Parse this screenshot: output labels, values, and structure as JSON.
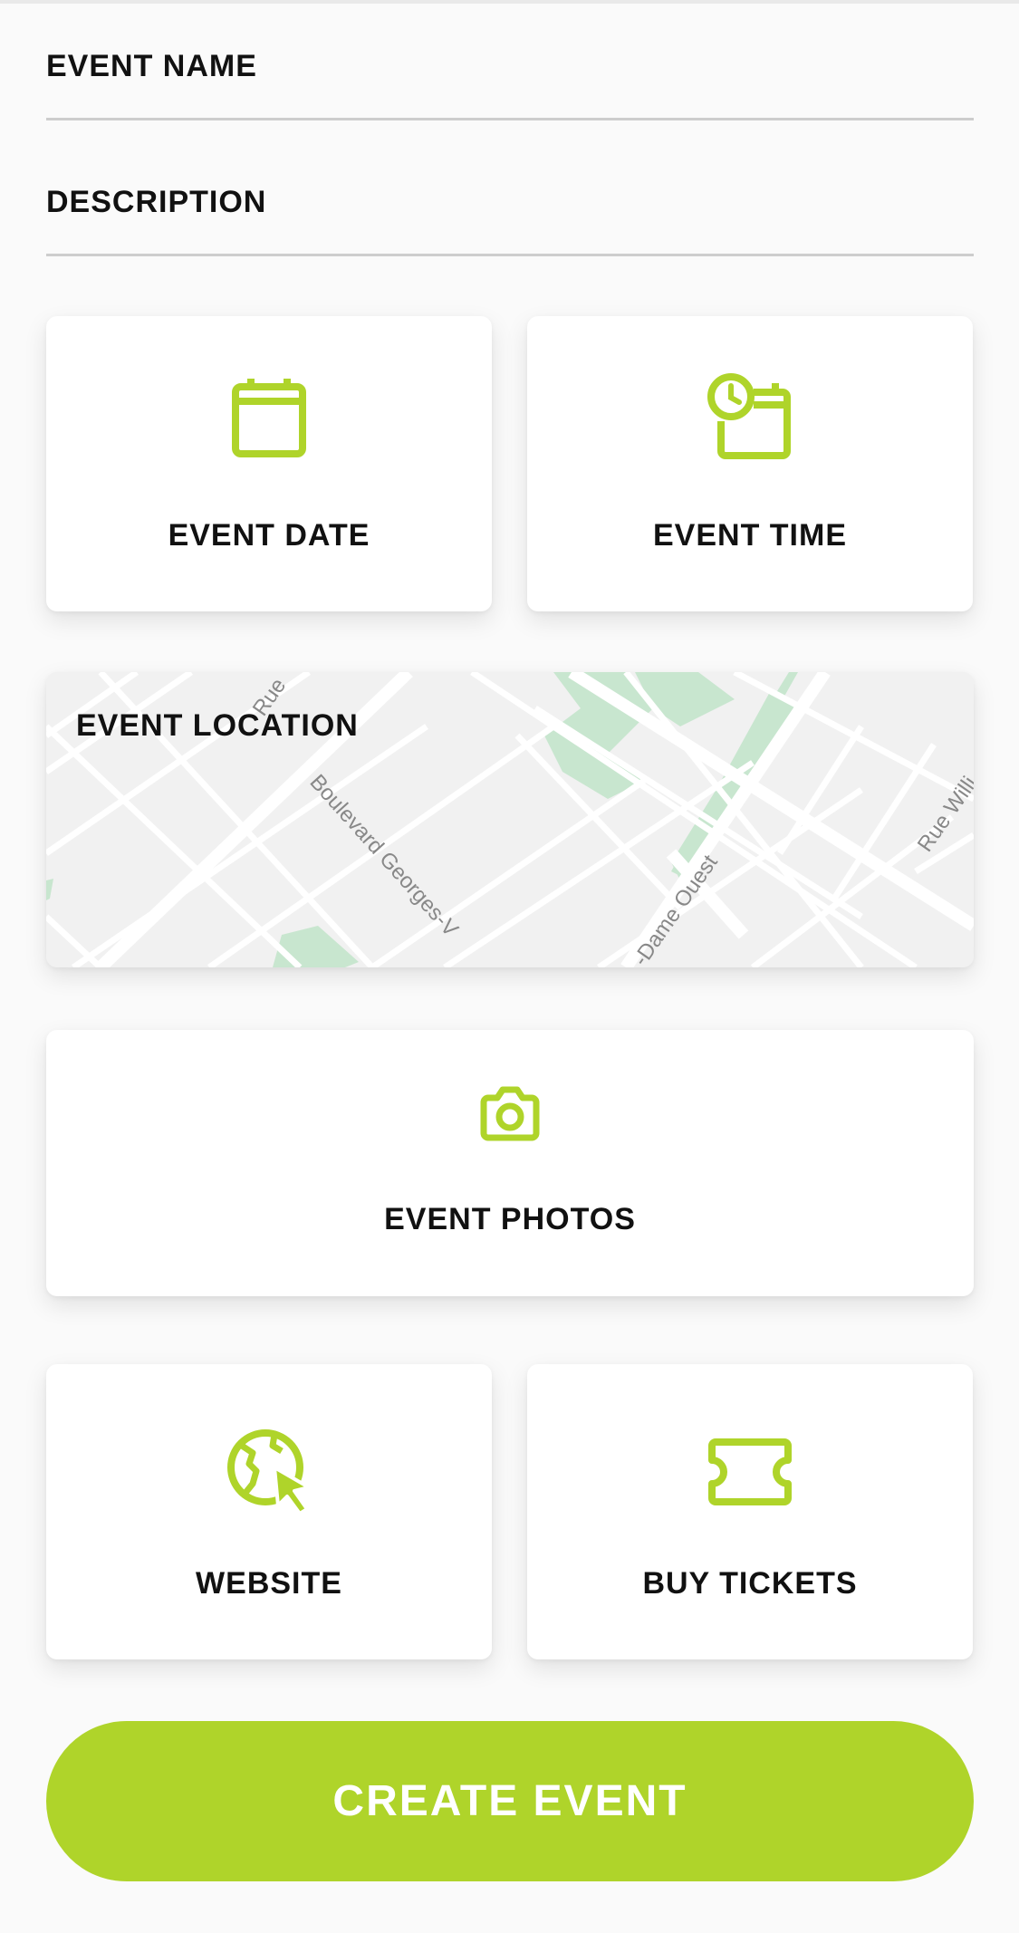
{
  "form": {
    "event_name_label": "EVENT NAME",
    "description_label": "DESCRIPTION"
  },
  "tiles": {
    "date": {
      "label": "EVENT DATE",
      "icon": "calendar-icon"
    },
    "time": {
      "label": "EVENT TIME",
      "icon": "clock-calendar-icon"
    },
    "location": {
      "label": "EVENT LOCATION",
      "streets": [
        "Rue",
        "Boulevard Georges-V",
        "-Dame Ouest",
        "Rue Willi"
      ]
    },
    "photos": {
      "label": "EVENT PHOTOS",
      "icon": "camera-icon"
    },
    "website": {
      "label": "WEBSITE",
      "icon": "globe-cursor-icon"
    },
    "tickets": {
      "label": "BUY TICKETS",
      "icon": "ticket-icon"
    }
  },
  "actions": {
    "create_label": "CREATE EVENT"
  },
  "colors": {
    "accent": "#afd42a",
    "background": "#fafafa",
    "map_green": "#c8e6cf"
  }
}
